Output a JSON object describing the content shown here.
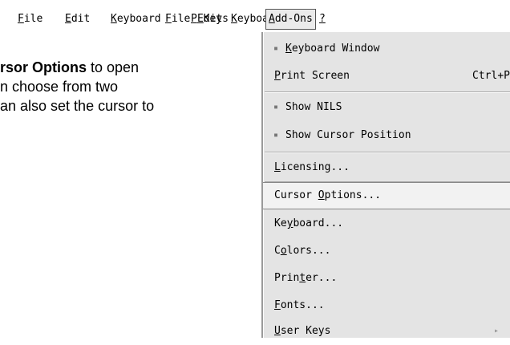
{
  "menubar": {
    "items": [
      {
        "pre": "",
        "u": "F",
        "post": "ile"
      },
      {
        "pre": "",
        "u": "E",
        "post": "dit"
      },
      {
        "pre": "",
        "u": "K",
        "post": "eyboard"
      },
      {
        "pre": "",
        "u": "P",
        "post": " Keys"
      },
      {
        "pre": "",
        "u": "A",
        "post": "dd-Ons"
      },
      {
        "pre": "",
        "u": "?",
        "post": ""
      }
    ]
  },
  "doc": {
    "line1_bold": "rsor Options",
    "line1_rest": " to open",
    "line2": "n choose from two",
    "line3": "an also set the cursor to"
  },
  "addons_menu": {
    "items": [
      {
        "pre": "",
        "u": "K",
        "post": "eyboard Window",
        "check": "▪",
        "shortcut": ""
      },
      {
        "pre": "",
        "u": "P",
        "post": "rint Screen",
        "check": "",
        "shortcut": "Ctrl+P"
      },
      {
        "pre": "Show NILS",
        "u": "",
        "post": "",
        "check": "▪",
        "shortcut": ""
      },
      {
        "pre": "Show Cursor Position",
        "u": "",
        "post": "",
        "check": "▪",
        "shortcut": ""
      },
      {
        "pre": "",
        "u": "L",
        "post": "icensing...",
        "check": "",
        "shortcut": ""
      },
      {
        "pre": "Cursor ",
        "u": "O",
        "post": "ptions...",
        "check": "",
        "shortcut": ""
      },
      {
        "pre": "Ke",
        "u": "y",
        "post": "board...",
        "check": "",
        "shortcut": ""
      },
      {
        "pre": "C",
        "u": "o",
        "post": "lors...",
        "check": "",
        "shortcut": ""
      },
      {
        "pre": "Prin",
        "u": "t",
        "post": "er...",
        "check": "",
        "shortcut": ""
      },
      {
        "pre": "",
        "u": "F",
        "post": "onts...",
        "check": "",
        "shortcut": ""
      },
      {
        "pre": "",
        "u": "U",
        "post": "ser Keys",
        "check": "",
        "shortcut": "",
        "arrow": "▸"
      }
    ]
  }
}
